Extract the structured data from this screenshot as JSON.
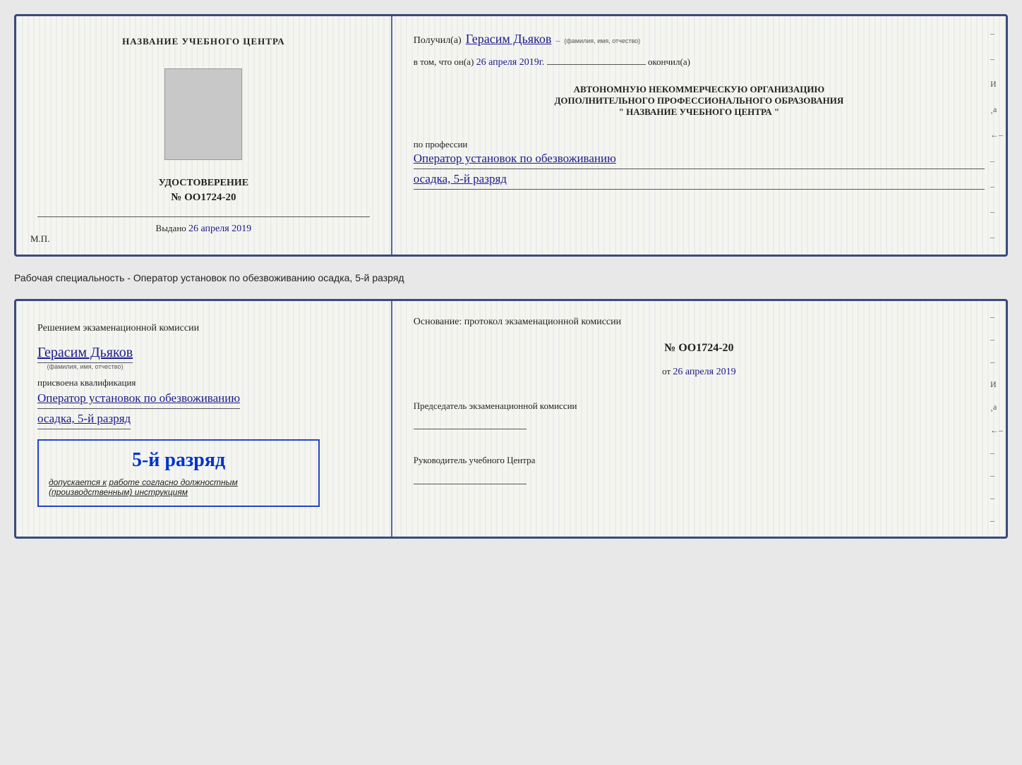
{
  "top_card": {
    "left": {
      "org_name": "НАЗВАНИЕ УЧЕБНОГО ЦЕНТРА",
      "doc_title": "УДОСТОВЕРЕНИЕ",
      "doc_number": "№ OO1724-20",
      "issued_label": "Выдано",
      "issued_date": "26 апреля 2019",
      "mp_label": "М.П."
    },
    "right": {
      "recipient_prefix": "Получил(а)",
      "recipient_name": "Герасим Дьяков",
      "recipient_sublabel": "(фамилия, имя, отчество)",
      "confirm_prefix": "в том, что он(а)",
      "confirm_date": "26 апреля 2019г.",
      "confirm_suffix": "окончил(а)",
      "org_line1": "АВТОНОМНУЮ НЕКОММЕРЧЕСКУЮ ОРГАНИЗАЦИЮ",
      "org_line2": "ДОПОЛНИТЕЛЬНОГО ПРОФЕССИОНАЛЬНОГО ОБРАЗОВАНИЯ",
      "org_line3": "\"   НАЗВАНИЕ УЧЕБНОГО ЦЕНТРА   \"",
      "profession_label": "по профессии",
      "profession_value": "Оператор установок по обезвоживанию",
      "rank_value": "осадка, 5-й разряд"
    }
  },
  "description": "Рабочая специальность - Оператор установок по обезвоживанию осадка, 5-й разряд",
  "bottom_card": {
    "left": {
      "commission_line1": "Решением экзаменационной  комиссии",
      "recipient_name": "Герасим Дьяков",
      "recipient_sublabel": "(фамилия, имя, отчество)",
      "qualification_label": "присвоена квалификация",
      "qualification_value1": "Оператор установок по обезвоживанию",
      "qualification_value2": "осадка, 5-й разряд",
      "stamp_rank": "5-й разряд",
      "stamp_sub_prefix": "допускается к",
      "stamp_sub_text": "работе согласно должностным",
      "stamp_sub_text2": "(производственным) инструкциям"
    },
    "right": {
      "basis_title": "Основание: протокол экзаменационной  комиссии",
      "number_prefix": "№",
      "number_value": "OO1724-20",
      "date_prefix": "от",
      "date_value": "26 апреля 2019",
      "chairman_label": "Председатель экзаменационной комиссии",
      "director_label": "Руководитель учебного Центра"
    }
  }
}
